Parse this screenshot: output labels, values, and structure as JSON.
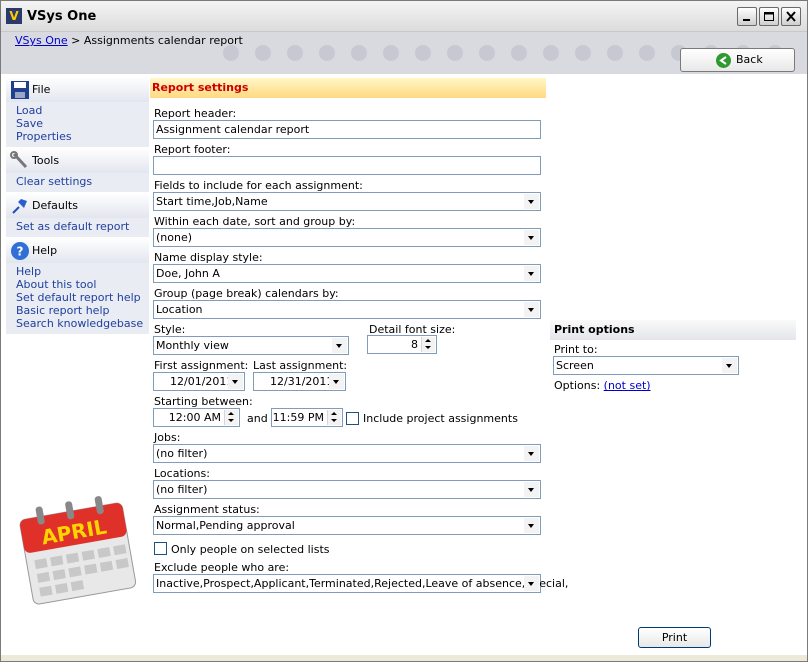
{
  "window": {
    "title": "VSys One"
  },
  "breadcrumb": {
    "root": "VSys One",
    "separator": ">",
    "current": "Assignments calendar report"
  },
  "back_button": {
    "label": "Back"
  },
  "sidebar": {
    "sections": [
      {
        "title": "File",
        "icon": "floppy-disk-icon",
        "items": [
          "Load",
          "Save",
          "Properties"
        ]
      },
      {
        "title": "Tools",
        "icon": "wrench-icon",
        "items": [
          "Clear settings"
        ]
      },
      {
        "title": "Defaults",
        "icon": "pushpin-icon",
        "items": [
          "Set as default report"
        ]
      },
      {
        "title": "Help",
        "icon": "help-icon",
        "items": [
          "Help",
          "About this tool",
          "Set default report help",
          "Basic report help",
          "Search knowledgebase"
        ]
      }
    ],
    "calendar_art_text": "APRIL"
  },
  "form": {
    "panel_title": "Report settings",
    "report_header": {
      "label": "Report header:",
      "value": "Assignment calendar report"
    },
    "report_footer": {
      "label": "Report footer:",
      "value": ""
    },
    "fields": {
      "label": "Fields to include for each assignment:",
      "value": "Start time,Job,Name"
    },
    "sort_group": {
      "label": "Within each date, sort and group by:",
      "value": "(none)"
    },
    "name_style": {
      "label": "Name display style:",
      "value": "Doe, John A"
    },
    "group_calendars": {
      "label": "Group (page break) calendars by:",
      "value": "Location"
    },
    "style": {
      "label": "Style:",
      "value": "Monthly view"
    },
    "detail_font": {
      "label": "Detail font size:",
      "value": "8"
    },
    "first_assignment": {
      "label": "First assignment:",
      "value": "12/01/2011"
    },
    "last_assignment": {
      "label": "Last assignment:",
      "value": "12/31/2011"
    },
    "starting_between": {
      "label": "Starting between:",
      "from": "12:00 AM",
      "and_label": "and",
      "to": "11:59 PM"
    },
    "include_project": {
      "label": "Include project assignments",
      "checked": false
    },
    "jobs": {
      "label": "Jobs:",
      "value": "(no filter)"
    },
    "locations": {
      "label": "Locations:",
      "value": "(no filter)"
    },
    "assignment_status": {
      "label": "Assignment status:",
      "value": "Normal,Pending approval"
    },
    "only_selected_lists": {
      "label": "Only people on selected lists",
      "checked": false
    },
    "exclude_people": {
      "label": "Exclude people who are:",
      "value": "Inactive,Prospect,Applicant,Terminated,Rejected,Leave of absence,Special,"
    }
  },
  "print_options": {
    "title": "Print options",
    "print_to": {
      "label": "Print to:",
      "value": "Screen"
    },
    "options": {
      "label": "Options:",
      "value": "(not set)"
    }
  },
  "print_button": {
    "label": "Print"
  }
}
